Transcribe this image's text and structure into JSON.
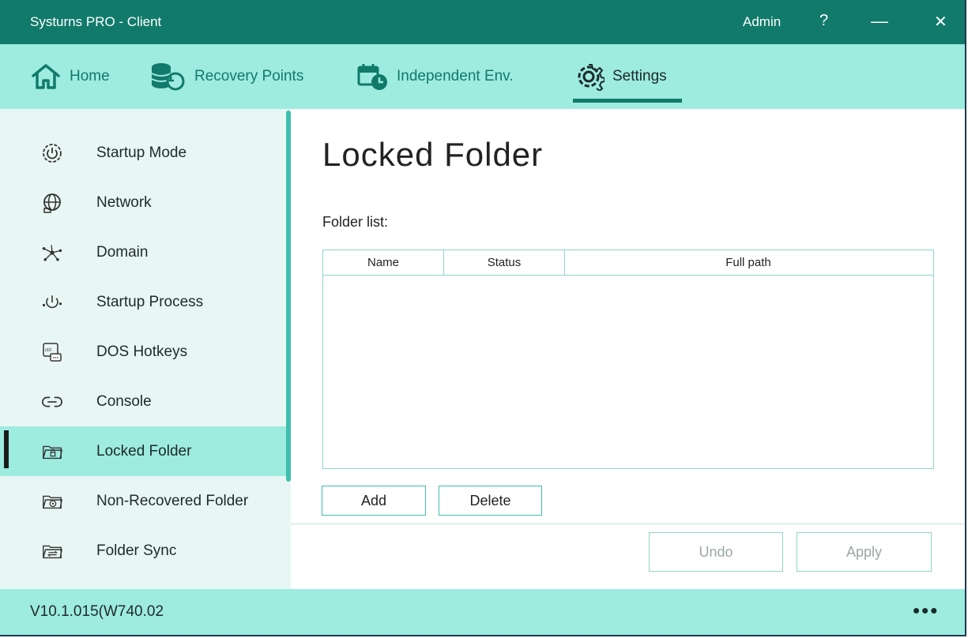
{
  "titlebar": {
    "title": "Systurns PRO - Client",
    "user": "Admin",
    "help": "?",
    "minimize": "—",
    "close": "✕"
  },
  "nav": {
    "tabs": [
      {
        "label": "Home",
        "icon": "home-icon"
      },
      {
        "label": "Recovery Points",
        "icon": "database-restore-icon"
      },
      {
        "label": "Independent Env.",
        "icon": "calendar-clock-icon"
      },
      {
        "label": "Settings",
        "icon": "gear-icon"
      }
    ],
    "active_tab": "Settings"
  },
  "sidebar": {
    "items": [
      {
        "label": "Startup Mode",
        "icon": "startup-mode-icon"
      },
      {
        "label": "Network",
        "icon": "network-globe-icon"
      },
      {
        "label": "Domain",
        "icon": "domain-hub-icon"
      },
      {
        "label": "Startup Process",
        "icon": "power-process-icon"
      },
      {
        "label": "DOS Hotkeys",
        "icon": "ctrl-key-icon"
      },
      {
        "label": "Console",
        "icon": "link-icon"
      },
      {
        "label": "Locked Folder",
        "icon": "locked-folder-icon"
      },
      {
        "label": "Non-Recovered Folder",
        "icon": "non-recovered-folder-icon"
      },
      {
        "label": "Folder Sync",
        "icon": "folder-sync-icon"
      }
    ],
    "active_item": "Locked Folder"
  },
  "main": {
    "title": "Locked Folder",
    "folder_list_label": "Folder list:",
    "table": {
      "columns": [
        "Name",
        "Status",
        "Full path"
      ],
      "rows": []
    },
    "add_label": "Add",
    "delete_label": "Delete",
    "undo_label": "Undo",
    "apply_label": "Apply"
  },
  "status": {
    "version": "V10.1.015(W740.02",
    "more": "•••"
  },
  "colors": {
    "titlebar": "#117a6b",
    "nav_bg": "#9eebe0",
    "sidebar_bg": "#e8f7f4",
    "accent": "#3fbfad"
  }
}
